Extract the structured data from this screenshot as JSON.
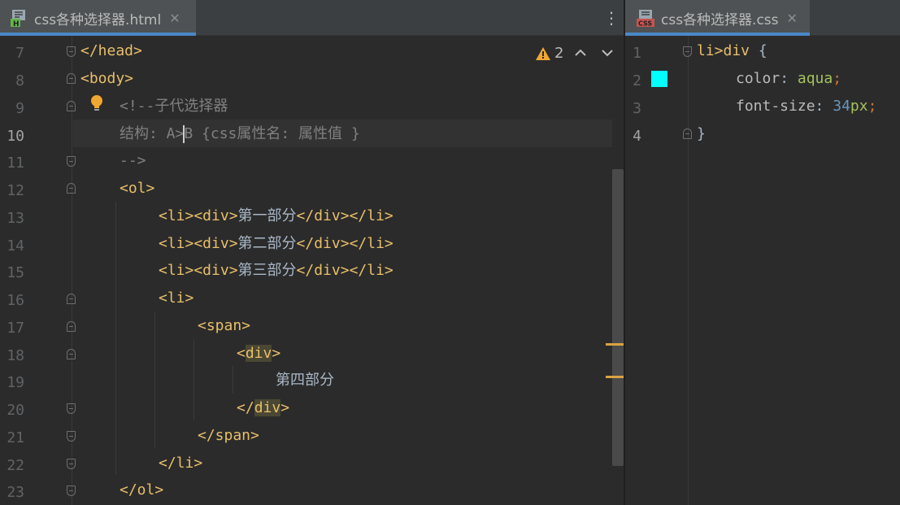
{
  "left_tab": {
    "title": "css各种选择器.html",
    "close": "✕",
    "icon": "html-file-icon"
  },
  "right_tab": {
    "title": "css各种选择器.css",
    "close": "✕",
    "icon": "css-file-icon"
  },
  "more_icon": "⋮",
  "inspections": {
    "count": "2",
    "icon": "warning-icon"
  },
  "left_editor": {
    "line_numbers": [
      "7",
      "8",
      "9",
      "10",
      "11",
      "12",
      "13",
      "14",
      "15",
      "16",
      "17",
      "18",
      "19",
      "20",
      "21",
      "22",
      "23"
    ],
    "active_line": "10",
    "lines": {
      "l7": "</head>",
      "l8": "<body>",
      "l9": "<!--子代选择器",
      "l10a": "结构: A>",
      "l10b": "B {css属性名: 属性值 }",
      "l11": "-->",
      "l12": "<ol>",
      "l13a": "<li><div>",
      "l13b": "第一部分",
      "l13c": "</div></li>",
      "l14a": "<li><div>",
      "l14b": "第二部分",
      "l14c": "</div></li>",
      "l15a": "<li><div>",
      "l15b": "第三部分",
      "l15c": "</div></li>",
      "l16": "<li>",
      "l17": "<span>",
      "l18a": "<",
      "l18b": "div",
      "l18c": ">",
      "l19": "第四部分",
      "l20a": "</",
      "l20b": "div",
      "l20c": ">",
      "l21": "</span>",
      "l22": "</li>",
      "l23": "</ol>"
    }
  },
  "right_editor": {
    "line_numbers": [
      "1",
      "2",
      "3",
      "4"
    ],
    "selector": "li>div",
    "open_brace": " {",
    "prop1": "color",
    "colon": ": ",
    "val1": "aqua",
    "semi": ";",
    "prop2": "font-size",
    "val2_num": "34",
    "val2_unit": "px",
    "close_brace": "}",
    "swatch_color": "#00ffff"
  },
  "colors": {
    "tab_accent": "#4a88c7",
    "tag": "#e8bf6a",
    "comment": "#808080",
    "marker": "#d9a343"
  }
}
